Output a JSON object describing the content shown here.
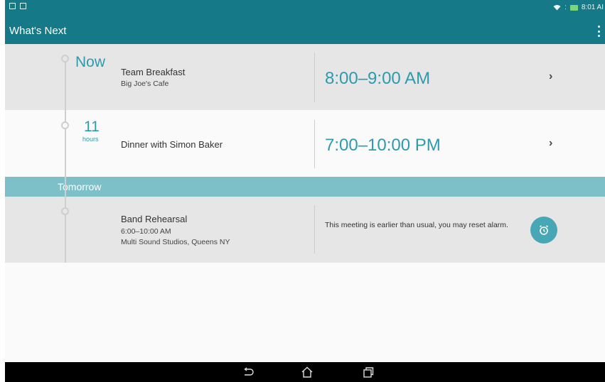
{
  "status_bar": {
    "time": "8:01 AI",
    "signal_icon": "wifi-icon",
    "signal_extra": ":",
    "battery_icon": "battery-icon"
  },
  "app_bar": {
    "title": "What's Next",
    "menu_icon": "overflow-menu-icon"
  },
  "events": [
    {
      "when_label": "Now",
      "title": "Team Breakfast",
      "subtitle": "Big Joe's Cafe",
      "time": "8:00–9:00 AM"
    },
    {
      "when_number": "11",
      "when_unit": "hours",
      "title": "Dinner with Simon Baker",
      "time": "7:00–10:00 PM"
    }
  ],
  "section": {
    "label": "Tomorrow"
  },
  "tomorrow_event": {
    "title": "Band Rehearsal",
    "time_line": "6:00–10:00 AM",
    "location": "Multi Sound Studios, Queens NY",
    "note": "This meeting is earlier than usual, you may reset alarm.",
    "action_icon": "alarm-clock-icon"
  },
  "nav_bar": {
    "back_icon": "back-icon",
    "home_icon": "home-icon",
    "recents_icon": "recents-icon"
  },
  "colors": {
    "primary": "#167987",
    "accent": "#2e9aab",
    "section_bg": "#7dc0c7",
    "card_gray": "#e6e6e6"
  }
}
